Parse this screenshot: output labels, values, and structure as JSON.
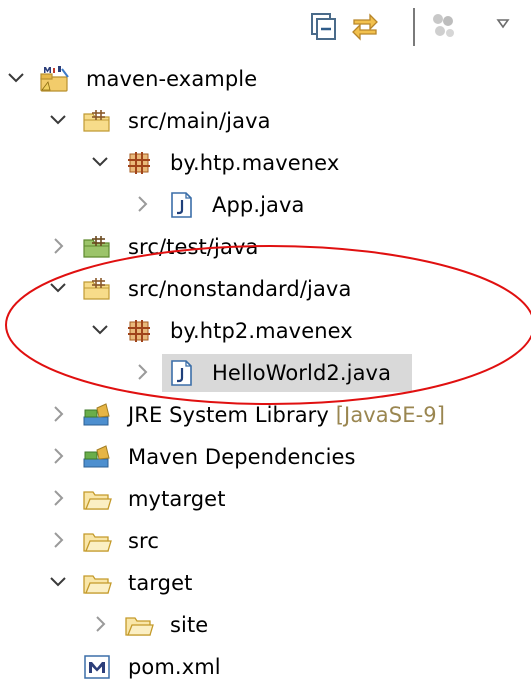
{
  "toolbar": {
    "icons": [
      "collapse-all-icon",
      "link-with-editor-icon",
      "focus-active-task-icon",
      "view-menu-icon"
    ]
  },
  "tree": [
    {
      "label": "maven-example",
      "decoration": "",
      "depth": 0,
      "state": "expanded",
      "icon": "maven-project-icon"
    },
    {
      "label": "src/main/java",
      "decoration": "",
      "depth": 1,
      "state": "expanded",
      "icon": "source-folder-icon"
    },
    {
      "label": "by.htp.mavenex",
      "decoration": "",
      "depth": 2,
      "state": "expanded",
      "icon": "package-icon"
    },
    {
      "label": "App.java",
      "decoration": "",
      "depth": 3,
      "state": "collapsed",
      "icon": "java-file-icon"
    },
    {
      "label": "src/test/java",
      "decoration": "",
      "depth": 1,
      "state": "collapsed",
      "icon": "test-source-folder-icon"
    },
    {
      "label": "src/nonstandard/java",
      "decoration": "",
      "depth": 1,
      "state": "expanded",
      "icon": "source-folder-icon"
    },
    {
      "label": "by.htp2.mavenex",
      "decoration": "",
      "depth": 2,
      "state": "expanded",
      "icon": "package-icon"
    },
    {
      "label": "HelloWorld2.java",
      "decoration": "",
      "depth": 3,
      "state": "collapsed",
      "icon": "java-file-icon",
      "selected": true
    },
    {
      "label": "JRE System Library",
      "decoration": " [JavaSE-9]",
      "depth": 1,
      "state": "collapsed",
      "icon": "library-icon"
    },
    {
      "label": "Maven Dependencies",
      "decoration": "",
      "depth": 1,
      "state": "collapsed",
      "icon": "library-icon"
    },
    {
      "label": "mytarget",
      "decoration": "",
      "depth": 1,
      "state": "collapsed",
      "icon": "folder-icon"
    },
    {
      "label": "src",
      "decoration": "",
      "depth": 1,
      "state": "collapsed",
      "icon": "folder-icon"
    },
    {
      "label": "target",
      "decoration": "",
      "depth": 1,
      "state": "expanded",
      "icon": "folder-icon"
    },
    {
      "label": "site",
      "decoration": "",
      "depth": 2,
      "state": "collapsed",
      "icon": "folder-icon"
    },
    {
      "label": "pom.xml",
      "decoration": "",
      "depth": 1,
      "state": "leaf",
      "icon": "maven-pom-icon"
    }
  ],
  "colors": {
    "annotation_ellipse": "#e01010",
    "selection": "#d9d9d9",
    "decoration_text": "#9a8650"
  }
}
